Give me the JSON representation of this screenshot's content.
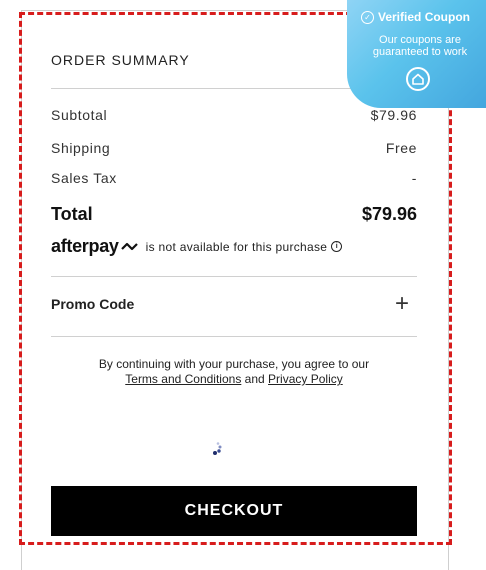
{
  "summary": {
    "title": "ORDER SUMMARY",
    "subtotal_label": "Subtotal",
    "subtotal_value": "$79.96",
    "shipping_label": "Shipping",
    "shipping_value": "Free",
    "tax_label": "Sales Tax",
    "tax_value": "-",
    "total_label": "Total",
    "total_value": "$79.96"
  },
  "afterpay": {
    "logo": "afterpay",
    "message": "is not available for this purchase"
  },
  "promo": {
    "label": "Promo Code"
  },
  "terms": {
    "prefix": "By continuing with your purchase, you agree to our",
    "terms_link": "Terms and Conditions",
    "conjunction": "and",
    "privacy_link": "Privacy Policy"
  },
  "checkout": {
    "label": "CHECKOUT"
  },
  "coupon": {
    "title": "Verified Coupon",
    "subtitle": "Our coupons are guaranteed to work"
  }
}
